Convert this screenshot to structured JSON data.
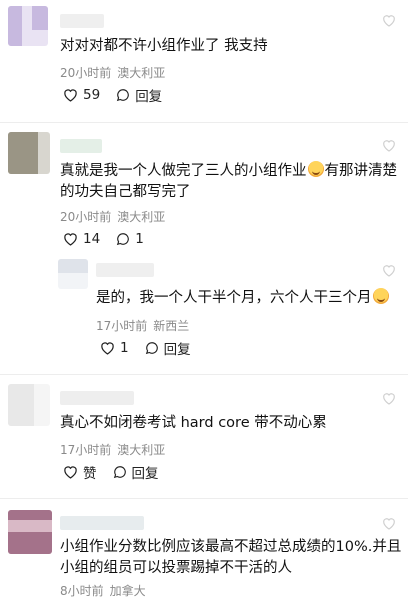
{
  "comments": [
    {
      "text_lines": [
        "对对对都不许小组作业了 我支持"
      ],
      "time": "20小时前",
      "location": "澳大利亚",
      "likes": "59",
      "reply_label": "回复",
      "avatar_colors": [
        "#c7b9df",
        "#e9e3f3"
      ],
      "name_color": "#efefef"
    },
    {
      "text_lines": [
        "真就是我一个人做完了三人的小组作业",
        "有那讲清楚",
        "的功夫自己都写完了"
      ],
      "time": "20小时前",
      "location": "澳大利亚",
      "likes": "14",
      "replies": "1",
      "avatar_colors": [
        "#9a9585",
        "#d8d6cf"
      ],
      "name_color": "#e4efe7"
    },
    {
      "text_lines": [
        "是的，我一个人干半个月，六个人干三个月"
      ],
      "time": "17小时前",
      "location": "新西兰",
      "likes": "1",
      "reply_label": "回复",
      "avatar_colors": [
        "#dfe3ea",
        "#f2f4f7"
      ],
      "name_color": "#efefef"
    },
    {
      "text_lines": [
        "真心不如闭卷考试 hard core 带不动心累"
      ],
      "time": "17小时前",
      "location": "澳大利亚",
      "like_label": "赞",
      "reply_label": "回复",
      "avatar_colors": [
        "#e8e8e8",
        "#f5f5f5"
      ],
      "name_color": "#eeeeee"
    },
    {
      "text_lines": [
        "小组作业分数比例应该最高不超过总成绩的10%.并且",
        "小组的组员可以投票踢掉不干活的人"
      ],
      "time": "8小时前",
      "location": "加拿大",
      "avatar_colors": [
        "#a4728a",
        "#d9b9c6"
      ],
      "name_color": "#e7ecee"
    }
  ],
  "icons": {
    "heart": "heart-icon",
    "reply": "speech-bubble-icon",
    "emoji": "grinning-face-emoji"
  }
}
